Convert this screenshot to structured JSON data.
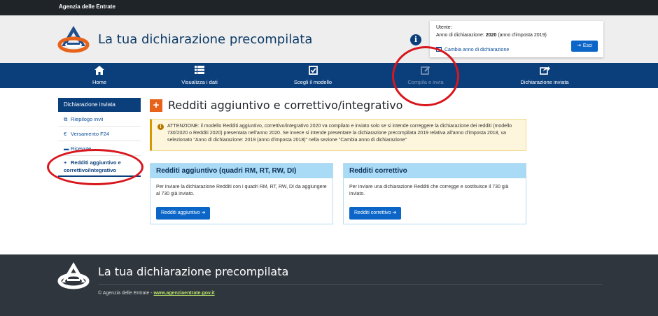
{
  "topbar": {
    "brand": "Agenzia delle Entrate"
  },
  "header": {
    "title": "La tua dichiarazione precompilata",
    "info_icon": "i",
    "user": {
      "label": "Utente:",
      "year_prefix": "Anno di dichiarazione: ",
      "year_value": "2020",
      "year_suffix": " (anno d'imposta 2019)",
      "change_year": "Cambia anno di dichiarazione",
      "exit": "Esci"
    }
  },
  "nav": {
    "items": [
      {
        "label": "Home",
        "icon": "home-icon"
      },
      {
        "label": "Visualizza i dati",
        "icon": "list-icon"
      },
      {
        "label": "Scegli il modello",
        "icon": "checkbox-icon"
      },
      {
        "label": "Compila e invia",
        "icon": "edit-icon"
      },
      {
        "label": "Dichiarazione inviata",
        "icon": "share-icon"
      }
    ]
  },
  "sidebar": {
    "heading": "Dichiarazione inviata",
    "items": [
      {
        "label": "Riepilogo invii",
        "icon": "external-link-icon"
      },
      {
        "label": "Versamento F24",
        "icon": "euro-icon"
      },
      {
        "label": "Ricevute",
        "icon": "folder-icon"
      },
      {
        "label": "Redditi aggiuntivo e correttivo/integrativo",
        "icon": "plus-icon"
      }
    ]
  },
  "main": {
    "title": "Redditi aggiuntivo e correttivo/integrativo",
    "alert": "ATTENZIONE: il modello Redditi aggiuntivo, correttivo/integrativo 2020 va compilato e inviato solo se si intende correggere la dichiarazione dei redditi (modello 730/2020 o Redditi 2020) presentata nell'anno 2020. Se invece si intende presentare la dichiarazione precompilata 2019 relativa all'anno d'imposta 2018, va selezionato \"Anno di dichiarazione: 2019 (anno d'imposta 2018)\" nella sezione \"Cambia anno di dichiarazione\"",
    "cards": [
      {
        "title": "Redditi aggiuntivo (quadri RM, RT, RW, DI)",
        "text": "Per inviare la dichiarazione Redditi con i quadri RM, RT, RW, DI da aggiungere al 730 già inviato.",
        "button": "Redditi aggiuntivo"
      },
      {
        "title": "Redditi correttivo",
        "text": "Per inviare una dichiarazione Redditi che corregge e sostituisce il 730 già inviato.",
        "button": "Redditi correttivo"
      }
    ]
  },
  "footer": {
    "title": "La tua dichiarazione precompilata",
    "copyright": "© Agenzia delle Entrate - ",
    "link": "www.agenziaentrate.gov.it"
  },
  "colors": {
    "nav": "#0b3f7c",
    "accent_orange": "#e8621a",
    "button_blue": "#0b66c8",
    "annotation_red": "#d8161d",
    "footer": "#30363d"
  }
}
